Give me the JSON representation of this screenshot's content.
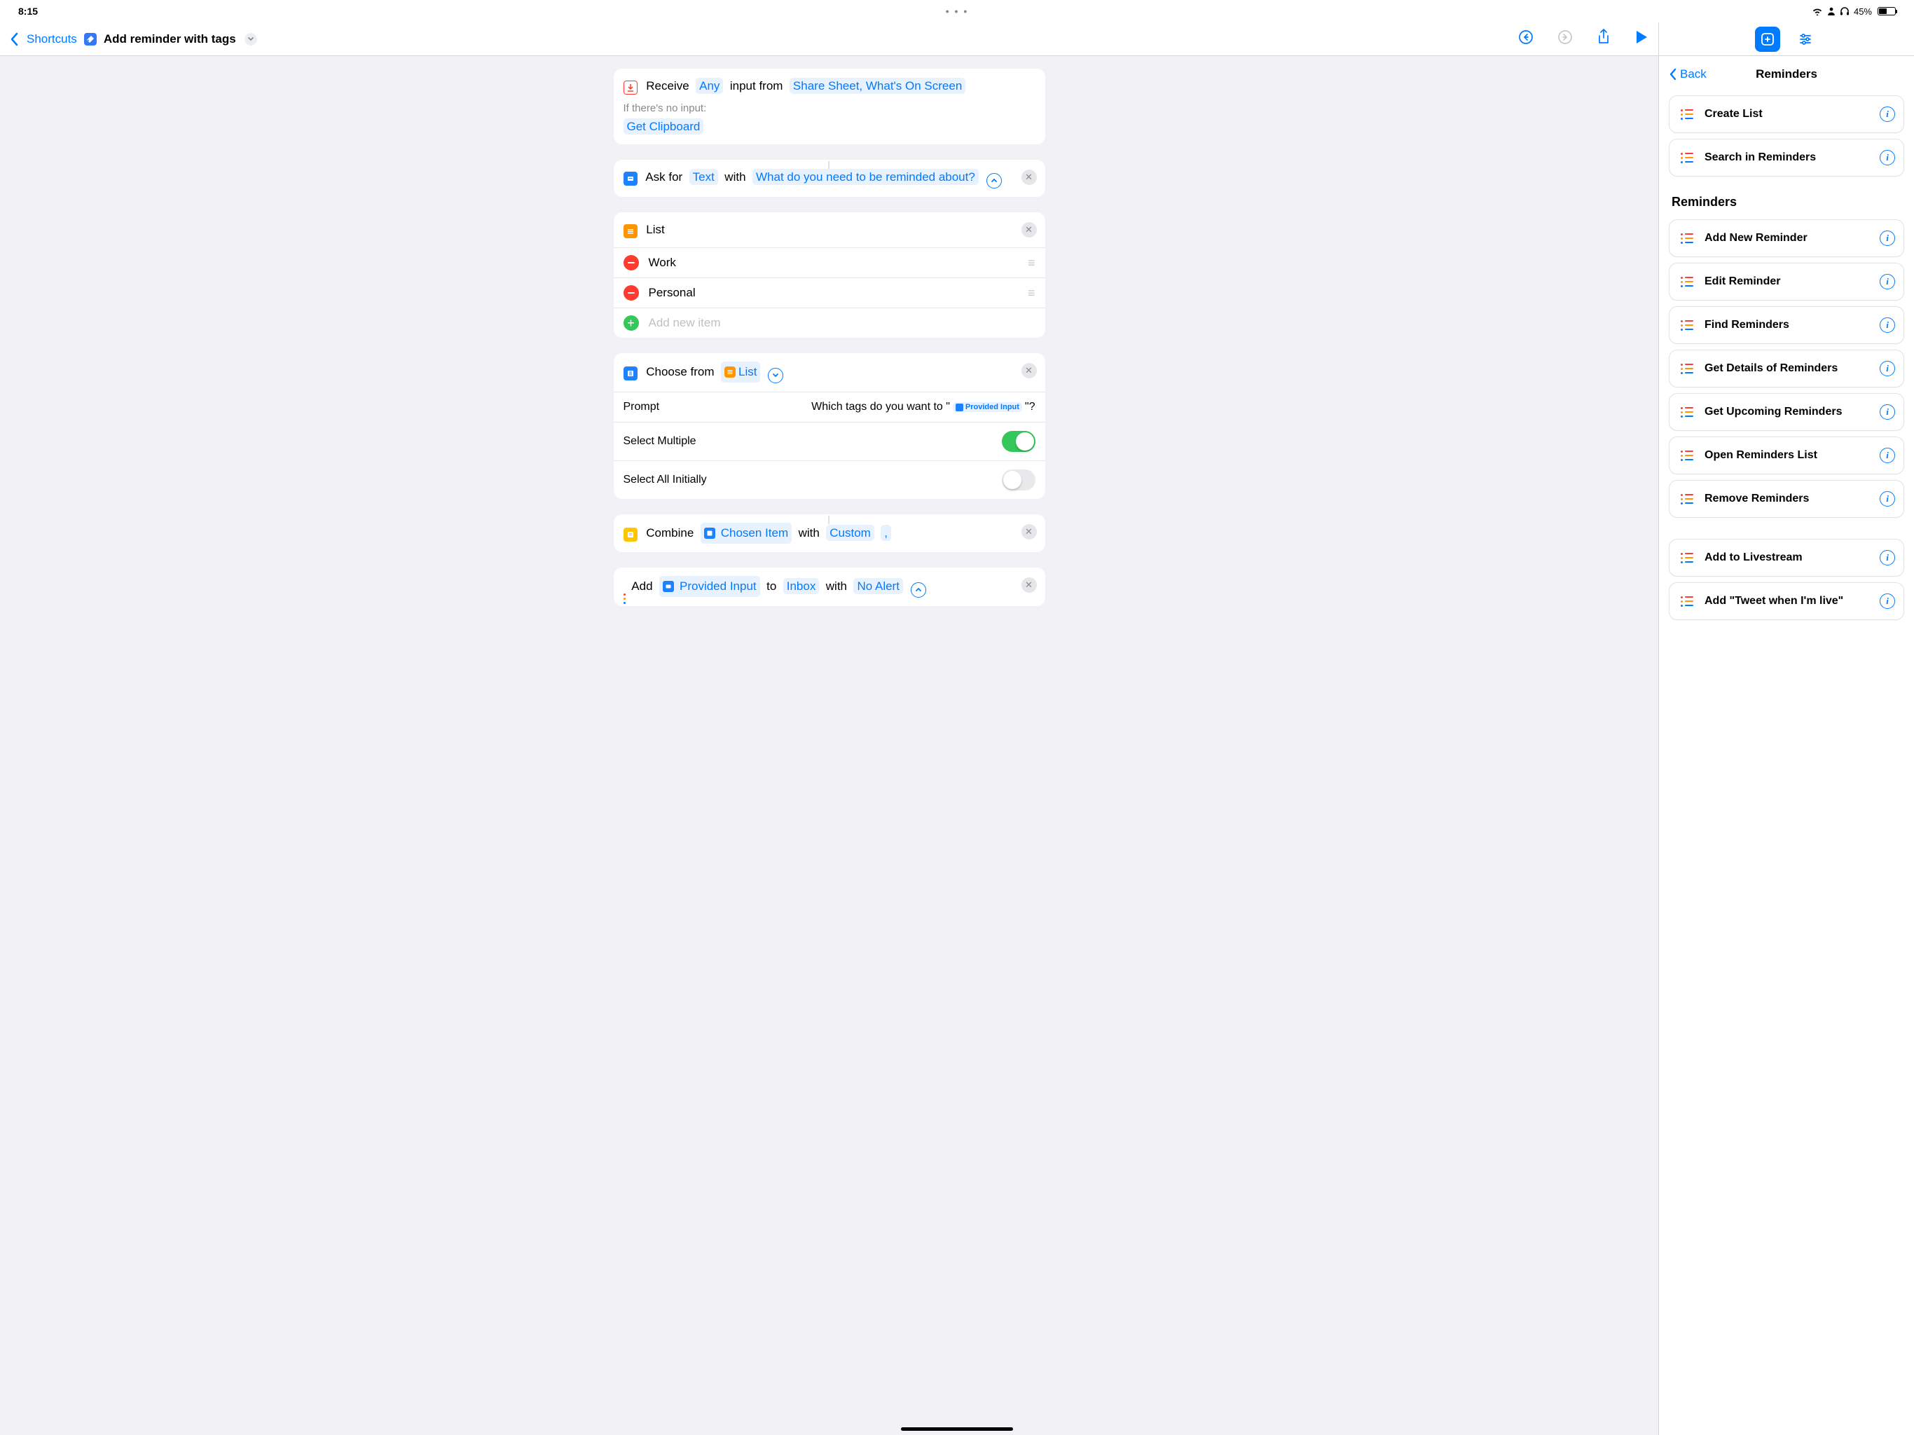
{
  "status": {
    "time": "8:15",
    "dots": "• • •",
    "battery_text": "45%"
  },
  "toolbar": {
    "back_label": "Shortcuts",
    "title": "Add reminder with tags"
  },
  "actions": {
    "receive": {
      "verb": "Receive",
      "any": "Any",
      "middle": "input from",
      "sources": "Share Sheet, What's On Screen",
      "noinput_label": "If there's no input:",
      "fallback": "Get Clipboard"
    },
    "ask": {
      "verb": "Ask for",
      "type": "Text",
      "with": "with",
      "prompt": "What do you need to be reminded about?"
    },
    "list": {
      "title": "List",
      "items": [
        "Work",
        "Personal"
      ],
      "add_placeholder": "Add new item"
    },
    "choose": {
      "verb": "Choose from",
      "source": "List",
      "prompt_label": "Prompt",
      "prompt_prefix": "Which tags do you want to \"",
      "prompt_var": "Provided Input",
      "prompt_suffix": "\"?",
      "select_multiple_label": "Select Multiple",
      "select_all_label": "Select All Initially"
    },
    "combine": {
      "verb": "Combine",
      "source": "Chosen Item",
      "with": "with",
      "mode": "Custom",
      "sep": ","
    },
    "add": {
      "verb": "Add",
      "what": "Provided Input",
      "to": "to",
      "list": "Inbox",
      "with": "with",
      "alert": "No Alert"
    }
  },
  "library": {
    "back": "Back",
    "title": "Reminders",
    "section1": [
      "Create List",
      "Search in Reminders"
    ],
    "section2_title": "Reminders",
    "section2": [
      "Add New Reminder",
      "Edit Reminder",
      "Find Reminders",
      "Get Details of Reminders",
      "Get Upcoming Reminders",
      "Open Reminders List",
      "Remove Reminders"
    ],
    "section3": [
      "Add to Livestream",
      "Add \"Tweet when I'm live\""
    ]
  }
}
